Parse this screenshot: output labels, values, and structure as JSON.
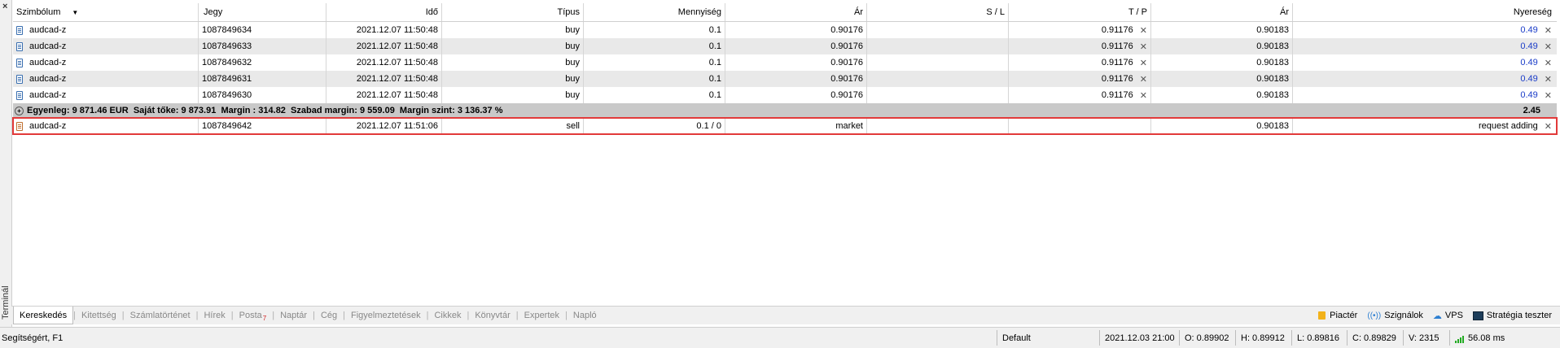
{
  "terminal": {
    "title": "Terminál",
    "close_glyph": "×"
  },
  "table": {
    "headers": {
      "symbol": "Szimbólum",
      "ticket": "Jegy",
      "time": "Idő",
      "type": "Típus",
      "volume": "Mennyiség",
      "price": "Ár",
      "sl": "S / L",
      "tp": "T / P",
      "current": "Ár",
      "profit": "Nyereség"
    },
    "rows": [
      {
        "symbol": "audcad-z",
        "ticket": "1087849634",
        "time": "2021.12.07 11:50:48",
        "type": "buy",
        "volume": "0.1",
        "price": "0.90176",
        "sl": "",
        "tp": "0.91176",
        "current": "0.90183",
        "profit": "0.49"
      },
      {
        "symbol": "audcad-z",
        "ticket": "1087849633",
        "time": "2021.12.07 11:50:48",
        "type": "buy",
        "volume": "0.1",
        "price": "0.90176",
        "sl": "",
        "tp": "0.91176",
        "current": "0.90183",
        "profit": "0.49"
      },
      {
        "symbol": "audcad-z",
        "ticket": "1087849632",
        "time": "2021.12.07 11:50:48",
        "type": "buy",
        "volume": "0.1",
        "price": "0.90176",
        "sl": "",
        "tp": "0.91176",
        "current": "0.90183",
        "profit": "0.49"
      },
      {
        "symbol": "audcad-z",
        "ticket": "1087849631",
        "time": "2021.12.07 11:50:48",
        "type": "buy",
        "volume": "0.1",
        "price": "0.90176",
        "sl": "",
        "tp": "0.91176",
        "current": "0.90183",
        "profit": "0.49"
      },
      {
        "symbol": "audcad-z",
        "ticket": "1087849630",
        "time": "2021.12.07 11:50:48",
        "type": "buy",
        "volume": "0.1",
        "price": "0.90176",
        "sl": "",
        "tp": "0.91176",
        "current": "0.90183",
        "profit": "0.49"
      }
    ],
    "summary": {
      "text": "Egyenleg: 9 871.46 EUR  Saját tőke: 9 873.91  Margin : 314.82  Szabad margin: 9 559.09  Margin szint: 3 136.37 %",
      "total": "2.45"
    },
    "pending": {
      "symbol": "audcad-z",
      "ticket": "1087849642",
      "time": "2021.12.07 11:51:06",
      "type": "sell",
      "volume": "0.1 / 0",
      "price": "market",
      "sl": "",
      "tp": "",
      "current": "0.90183",
      "profit": "request adding"
    }
  },
  "tabs": [
    {
      "label": "Kereskedés"
    },
    {
      "label": "Kitettség"
    },
    {
      "label": "Számlatörténet"
    },
    {
      "label": "Hírek"
    },
    {
      "label": "Posta",
      "badge": "7"
    },
    {
      "label": "Naptár"
    },
    {
      "label": "Cég"
    },
    {
      "label": "Figyelmeztetések"
    },
    {
      "label": "Cikkek"
    },
    {
      "label": "Könyvtár"
    },
    {
      "label": "Expertek"
    },
    {
      "label": "Napló"
    }
  ],
  "tools": {
    "market": "Piactér",
    "signals": "Szignálok",
    "vps": "VPS",
    "tester": "Stratégia teszter"
  },
  "status": {
    "help": "Segítségért, F1",
    "profile": "Default",
    "datetime": "2021.12.03 21:00",
    "open": "O: 0.89902",
    "high": "H: 0.89912",
    "low": "L: 0.89816",
    "close": "C: 0.89829",
    "volume": "V: 2315",
    "ping": "56.08 ms"
  },
  "colors": {
    "profit_blue": "#1a3cc8",
    "highlight_red": "#e23a3a",
    "badge_red": "#d02020"
  }
}
